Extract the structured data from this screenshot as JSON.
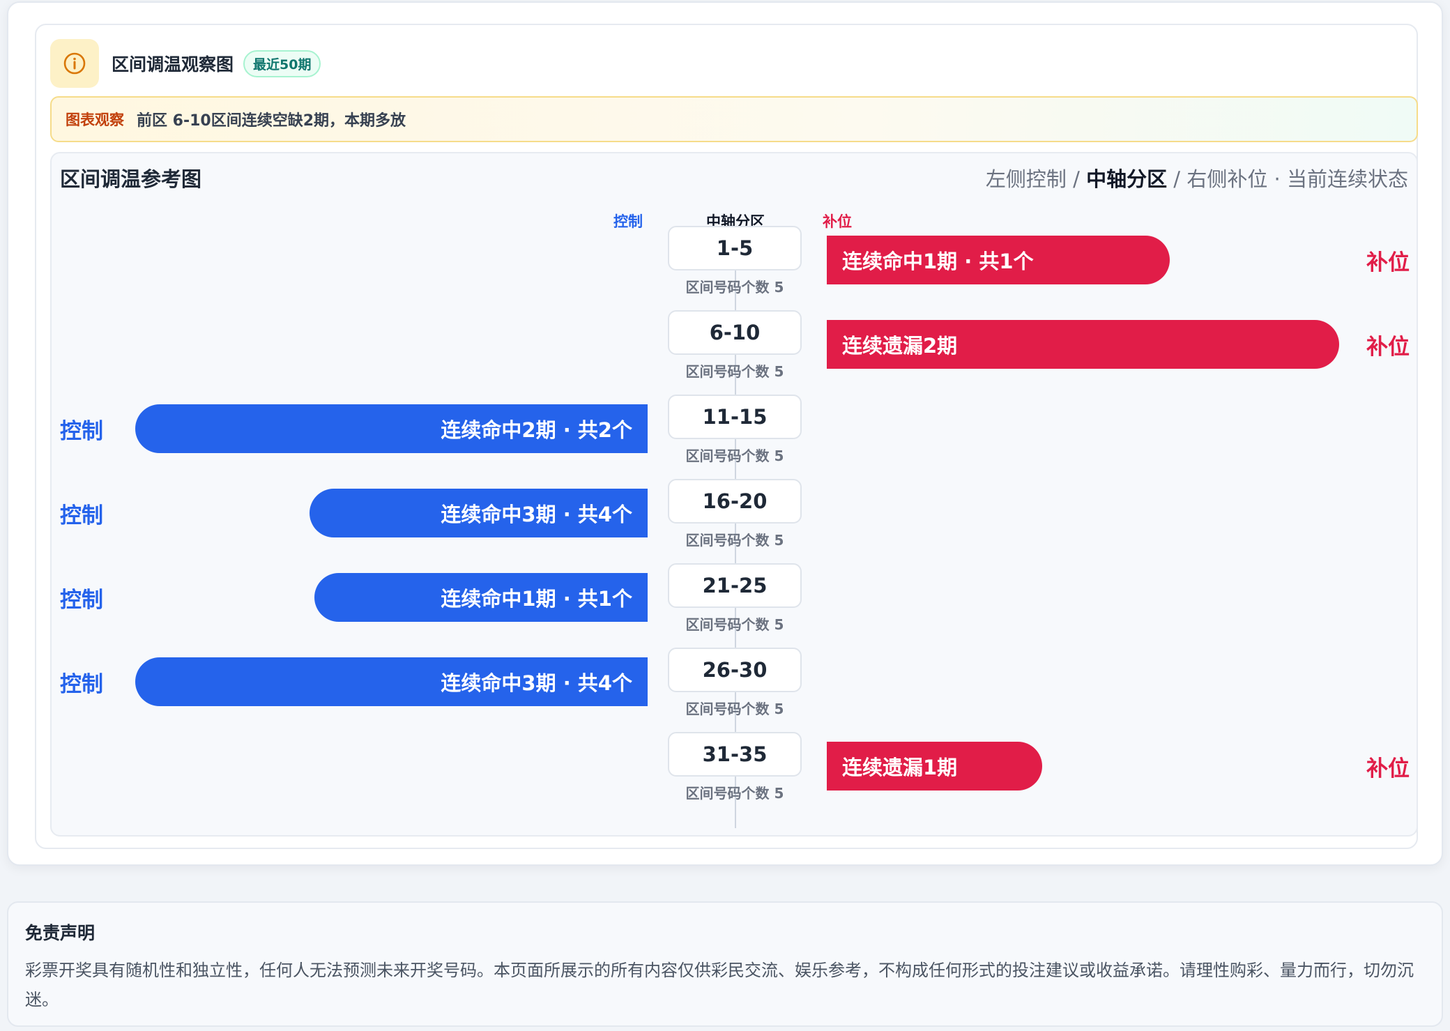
{
  "header": {
    "title": "区间调温观察图",
    "badge": "最近50期"
  },
  "observation": {
    "tag": "图表观察",
    "text": "前区 6-10区间连续空缺2期，本期多放"
  },
  "chart_panel": {
    "title": "区间调温参考图",
    "legend_left": "左侧控制",
    "legend_sep1": " / ",
    "legend_center": "中轴分区",
    "legend_sep2": " / ",
    "legend_right": "右侧补位",
    "legend_dot": "  ·  ",
    "legend_state": "当前连续状态"
  },
  "colors": {
    "control": "#2563eb",
    "supplement": "#e11d48"
  },
  "chart_data": {
    "type": "bar",
    "column_headers": {
      "left": "控制",
      "center": "中轴分区",
      "right": "补位"
    },
    "categories": [
      "1-5",
      "6-10",
      "11-15",
      "16-20",
      "21-25",
      "26-30",
      "31-35"
    ],
    "count_labels": [
      "区间号码个数 5",
      "区间号码个数 5",
      "区间号码个数 5",
      "区间号码个数 5",
      "区间号码个数 5",
      "区间号码个数 5",
      "区间号码个数 5"
    ],
    "rows": [
      {
        "zone": "1-5",
        "side": "right",
        "magnitude": 0.67,
        "bar_text": "连续命中1期 · 共1个",
        "side_label": "补位"
      },
      {
        "zone": "6-10",
        "side": "right",
        "magnitude": 1.0,
        "bar_text": "连续遗漏2期",
        "side_label": "补位"
      },
      {
        "zone": "11-15",
        "side": "left",
        "magnitude": 1.0,
        "bar_text": "连续命中2期 · 共2个",
        "side_label": "控制"
      },
      {
        "zone": "16-20",
        "side": "left",
        "magnitude": 0.66,
        "bar_text": "连续命中3期 · 共4个",
        "side_label": "控制"
      },
      {
        "zone": "21-25",
        "side": "left",
        "magnitude": 0.65,
        "bar_text": "连续命中1期 · 共1个",
        "side_label": "控制"
      },
      {
        "zone": "26-30",
        "side": "left",
        "magnitude": 1.0,
        "bar_text": "连续命中3期 · 共4个",
        "side_label": "控制"
      },
      {
        "zone": "31-35",
        "side": "right",
        "magnitude": 0.42,
        "bar_text": "连续遗漏1期",
        "side_label": "补位"
      }
    ]
  },
  "disclaimer": {
    "title": "免责声明",
    "text": "彩票开奖具有随机性和独立性，任何人无法预测未来开奖号码。本页面所展示的所有内容仅供彩民交流、娱乐参考，不构成任何形式的投注建议或收益承诺。请理性购彩、量力而行，切勿沉迷。"
  }
}
